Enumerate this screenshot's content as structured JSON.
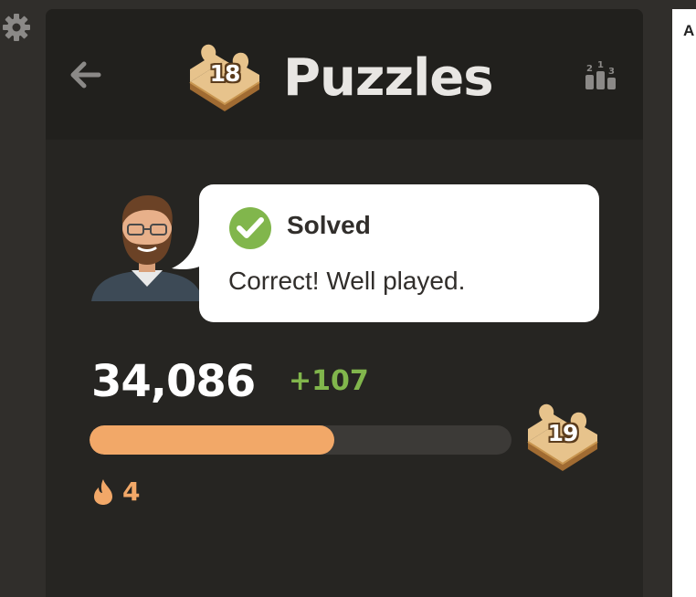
{
  "header": {
    "title": "Puzzles",
    "level_badge": "18",
    "back_icon": "arrow-left-icon",
    "leaderboard_icon": "leaderboard-podium-icon",
    "podium_digits": [
      "2",
      "1",
      "3"
    ]
  },
  "settings": {
    "icon": "gear-icon"
  },
  "feedback": {
    "status": "Solved",
    "message": "Correct! Well played.",
    "icon": "check-circle-icon"
  },
  "rating": {
    "value": "34,086",
    "change": "+107"
  },
  "progress": {
    "fraction": 0.58,
    "next_badge": "19"
  },
  "streak": {
    "icon": "flame-icon",
    "count": "4"
  },
  "side_panel": {
    "letter": "A"
  },
  "colors": {
    "accent_green": "#81b64c",
    "progress_orange": "#f2a868",
    "panel_bg": "#262522",
    "page_bg": "#302e2b"
  }
}
